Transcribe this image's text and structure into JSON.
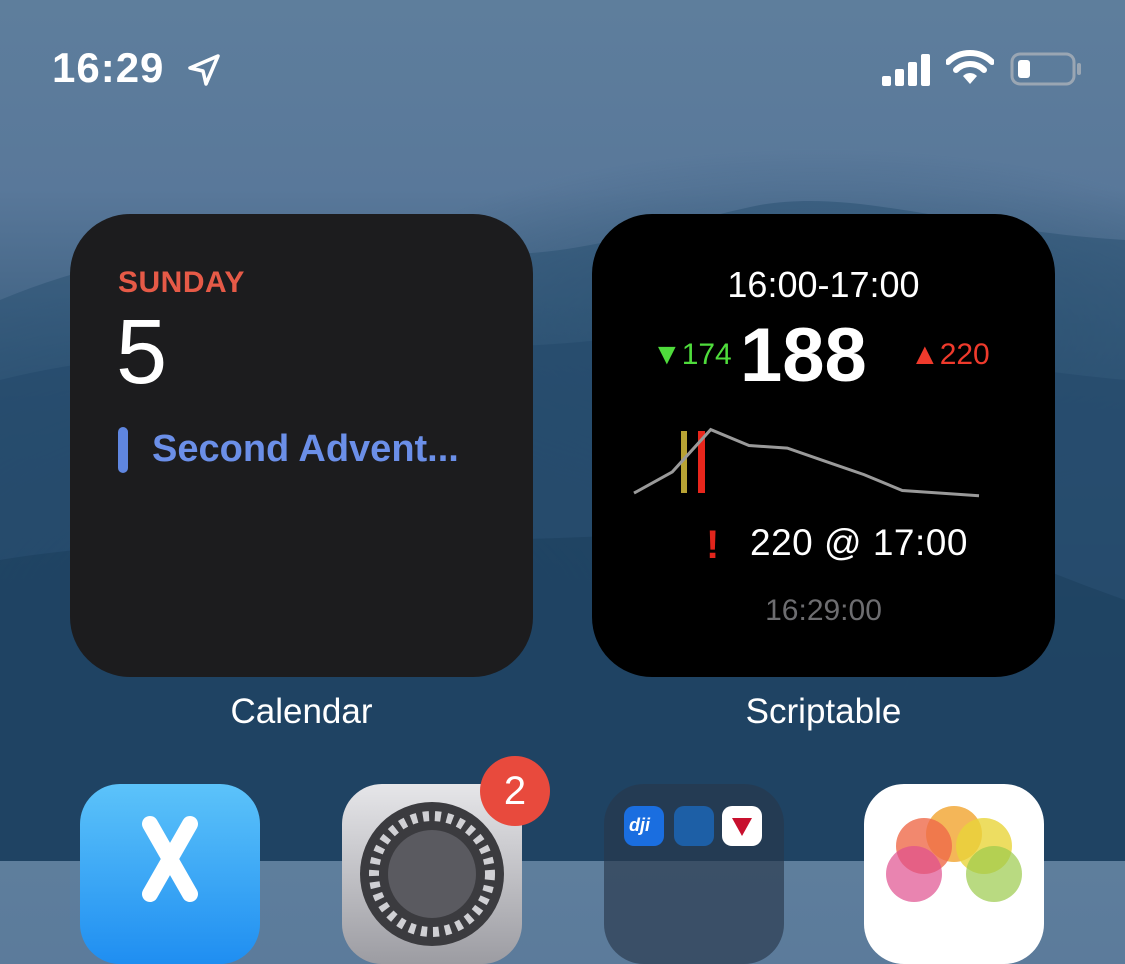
{
  "status_bar": {
    "time": "16:29",
    "location_icon": "location-arrow-icon",
    "signal_icon": "cellular-signal-icon",
    "wifi_icon": "wifi-icon",
    "battery_icon": "battery-low-icon"
  },
  "calendar_widget": {
    "day": "SUNDAY",
    "date": "5",
    "event": "Second Advent...",
    "label": "Calendar",
    "colors": {
      "day": "#e65a47",
      "event": "#6b8fe8"
    }
  },
  "scriptable_widget": {
    "time_range": "16:00-17:00",
    "low": "▼174",
    "current": "188",
    "high": "▲220",
    "alert": "220 @ 17:00",
    "updated": "16:29:00",
    "label": "Scriptable",
    "colors": {
      "low": "#4fdc3c",
      "high": "#ef3a2c",
      "line": "#9a9a9a"
    },
    "trend_values": [
      174,
      182,
      198,
      192,
      191,
      186,
      181,
      175,
      174,
      173
    ]
  },
  "dock_row": {
    "apps": [
      {
        "name": "app-store-icon"
      },
      {
        "name": "settings-icon",
        "badge": "2"
      },
      {
        "name": "app-folder-icon",
        "folder_app_text": "dji"
      },
      {
        "name": "photos-icon"
      }
    ]
  }
}
